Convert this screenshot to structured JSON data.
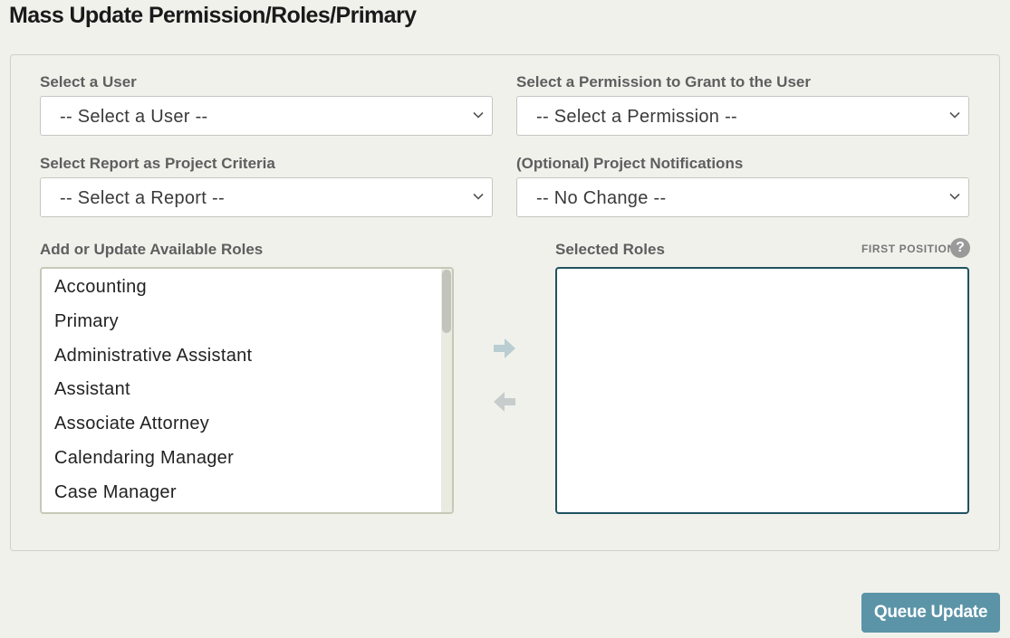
{
  "page": {
    "title": "Mass Update Permission/Roles/Primary"
  },
  "user_select": {
    "label": "Select a User",
    "value": "-- Select a User --"
  },
  "permission_select": {
    "label": "Select a Permission to Grant to the User",
    "value": "-- Select a Permission --"
  },
  "report_select": {
    "label": "Select Report as Project Criteria",
    "value": "-- Select a Report --"
  },
  "notifications_select": {
    "label": "(Optional) Project Notifications",
    "value": "-- No Change --"
  },
  "available_roles": {
    "label": "Add or Update Available Roles",
    "items": [
      "Accounting",
      "Primary",
      "Administrative Assistant",
      "Assistant",
      "Associate Attorney",
      "Calendaring Manager",
      "Case Manager"
    ]
  },
  "selected_roles": {
    "label": "Selected Roles",
    "first_position_label": "FIRST POSITION",
    "items": []
  },
  "actions": {
    "queue_update_label": "Queue Update"
  },
  "icons": {
    "add_role": "arrow-right-icon",
    "remove_role": "arrow-left-icon",
    "help": "question-circle-icon",
    "dropdown": "chevron-down-icon"
  },
  "colors": {
    "accent": "#5b94a7",
    "selected_border": "#1f5360",
    "arrow": "#b9cdd2",
    "background": "#f1f1ec"
  }
}
